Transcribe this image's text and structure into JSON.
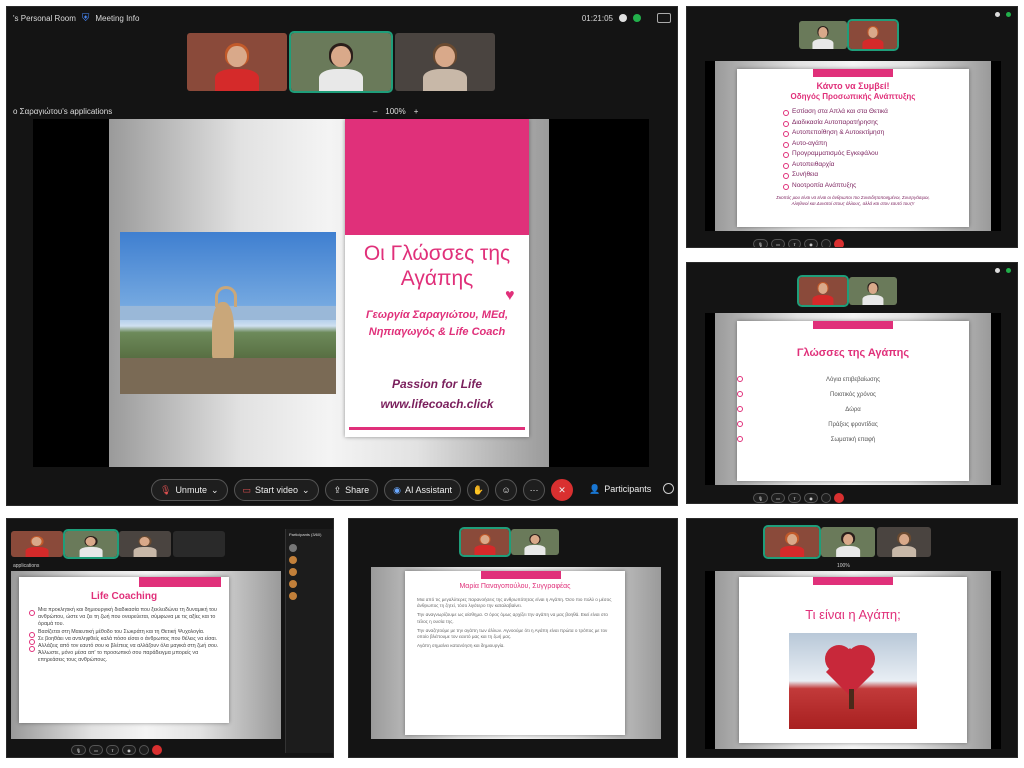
{
  "main": {
    "room_title": "'s Personal Room",
    "meeting_info": "Meeting Info",
    "time": "01:21:05",
    "apps_label": "ο Σαραγιώτου's applications",
    "zoom": "100%",
    "zoom_minus": "–",
    "zoom_plus": "+",
    "slide": {
      "title": "Οι Γλώσσες της Αγάπης",
      "author": "Γεωργία Σαραγιώτου, MEd, Νηπιαγωγός & Life Coach",
      "tagline": "Passion for Life",
      "url": "www.lifecoach.click",
      "heart": "♥"
    },
    "controls": {
      "unmute": "Unmute",
      "start_video": "Start video",
      "share": "Share",
      "ai_assistant": "AI Assistant",
      "more": "···",
      "end": "✕",
      "participants": "Participants"
    }
  },
  "panel_tr": {
    "title": "Κάντο να Συμβεί!",
    "subtitle": "Οδηγός Προσωπικής Ανάπτυξης",
    "items": [
      "Εστίαση στα Απλά και στα Θετικά",
      "Διαδικασία Αυτοπαρατήρησης",
      "Αυτοπεποίθηση & Αυτοεκτίμηση",
      "Αυτο-αγάπη",
      "Προγραμματισμός Εγκεφάλου",
      "Αυτοπειθαρχία",
      "Συνήθεια",
      "Νοοτροπία Ανάπτυξης"
    ],
    "footer": "Σκοπός μου είναι να είναι οι άνθρωποι πιο Συνειδητοποιημένοι, Συνεργάσιμοι, Αληθινοί και Δυνατοί στους άλλους, αλλά και στον εαυτό τους!!"
  },
  "panel_mr": {
    "title": "Γλώσσες της Αγάπης",
    "items": [
      "Λόγια επιβεβαίωσης",
      "Ποιοτικός χρόνος",
      "Δώρα",
      "Πράξεις φροντίδας",
      "Σωματική επαφή"
    ]
  },
  "panel_bl": {
    "apps_label": "applications",
    "participants_header": "Participants (3/60)",
    "title": "Life Coaching",
    "items": [
      "Μια προκλητική και δημιουργική διαδικασία που ξεκλειδώνει τη δυναμική του ανθρώπου, ώστε να ζει τη ζωή που ονειρεύεται, σύμφωνα με τις αξίες και το όραμά του.",
      "Βασίζεται στη Μαιευτική μέθοδο του Σωκράτη και τη Θετική Ψυχολογία.",
      "Σε βοηθάει να αντιληφθείς καλά πόσο είσαι ο άνθρωπος που θέλεις να είσαι.",
      "Αλλάζεις από τον εαυτό σου κι βλέπεις να αλλάζουν όλα μαγικά στη ζωή σου. Άλλωστε, μόνο μέσα απ' το προσωπικό σου παράδειγμα μπορείς να επηρεάσεις τους ανθρώπους."
    ]
  },
  "panel_bm": {
    "title": "Μαρία Παναγοπούλου, Συγγραφέας",
    "paragraphs": [
      "Μια από τις μεγαλύτερες παρανοήσεις της ανθρωπότητας είναι η Αγάπη. Όσο πιο πολύ ο μέσος άνθρωπος τη ζητεί, τόσο λιγότερο την καταλαβαίνει.",
      "Την αναγνωρίζουμε ως αίσθημα. Ο όρος όμως αρχίζει την αγάπη να μας βοηθά. Εκεί είναι στο τέλος η ουσία της.",
      "Την αναζητούμε με την αγάπη των άλλων. Αγνοούμε ότι η Αγάπη είναι πρώτα ο τρόπος με τον οποίο βλέπουμε τον εαυτό μας και τη ζωή μας.",
      "Αγάπη σημαίνει κατανόηση και δημιουργία."
    ]
  },
  "panel_br": {
    "title": "Τι είναι η Αγάπη;",
    "zoom": "100%"
  },
  "colors": {
    "accent": "#e0307a",
    "dark_purple": "#7a1f5c",
    "end_red": "#d93030",
    "active_outline": "#1f9e7a"
  }
}
